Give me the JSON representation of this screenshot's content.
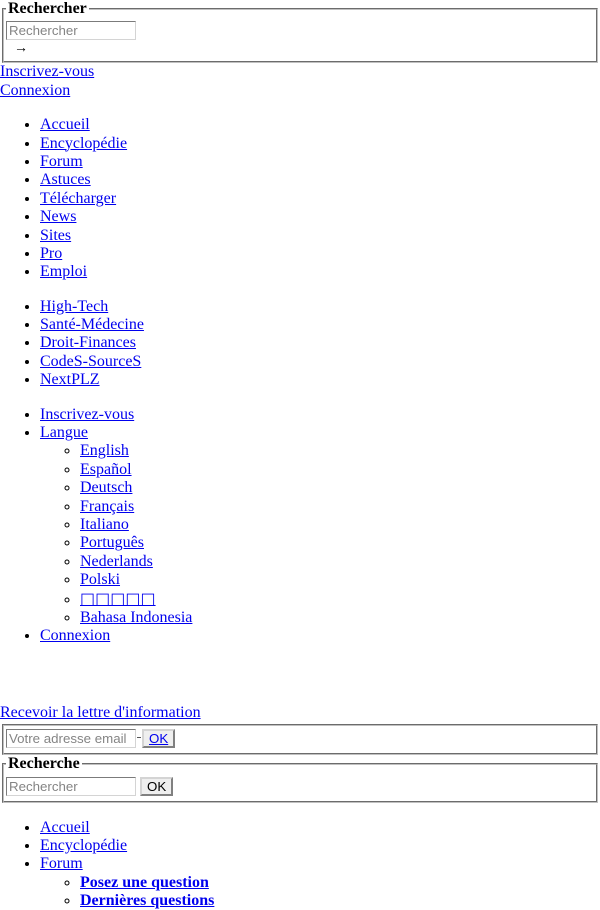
{
  "search_top": {
    "legend": "Rechercher",
    "input_placeholder": "Rechercher",
    "input_value": "",
    "submit_label": "→"
  },
  "top_links": [
    {
      "label": "Inscrivez-vous"
    },
    {
      "label": "Connexion"
    }
  ],
  "main_nav": [
    {
      "label": "Accueil"
    },
    {
      "label": "Encyclopédie"
    },
    {
      "label": "Forum"
    },
    {
      "label": "Astuces"
    },
    {
      "label": "Télécharger"
    },
    {
      "label": "News"
    },
    {
      "label": "Sites"
    },
    {
      "label": "Pro"
    },
    {
      "label": "Emploi"
    }
  ],
  "sites_nav": [
    {
      "label": "High-Tech"
    },
    {
      "label": "Santé-Médecine"
    },
    {
      "label": "Droit-Finances"
    },
    {
      "label": "CodeS-SourceS"
    },
    {
      "label": "NextPLZ"
    }
  ],
  "account_nav": {
    "signup_label": "Inscrivez-vous",
    "language_label": "Langue",
    "languages": [
      {
        "label": "English"
      },
      {
        "label": "Español"
      },
      {
        "label": "Deutsch"
      },
      {
        "label": "Français"
      },
      {
        "label": "Italiano"
      },
      {
        "label": "Português"
      },
      {
        "label": "Nederlands"
      },
      {
        "label": "Polski"
      },
      {
        "label": "□□□□□"
      },
      {
        "label": "Bahasa Indonesia"
      }
    ],
    "login_label": "Connexion"
  },
  "newsletter": {
    "link_label": "Recevoir la lettre d'information",
    "input_placeholder": "Votre adresse email",
    "input_value": "",
    "submit_label": "OK"
  },
  "search_bottom": {
    "legend": "Recherche",
    "input_placeholder": "Rechercher",
    "input_value": "",
    "submit_label": "OK"
  },
  "footer_nav": [
    {
      "label": "Accueil",
      "bold": false,
      "children": []
    },
    {
      "label": "Encyclopédie",
      "bold": false,
      "children": []
    },
    {
      "label": "Forum",
      "bold": false,
      "children": [
        {
          "label": "Posez une question",
          "bold": true
        },
        {
          "label": "Dernières questions",
          "bold": true
        }
      ]
    }
  ],
  "colors": {
    "link": "#0000EE",
    "text": "#000000",
    "background": "#FFFFFF",
    "fieldset_border": "#C0C0C0",
    "placeholder": "#848484"
  }
}
